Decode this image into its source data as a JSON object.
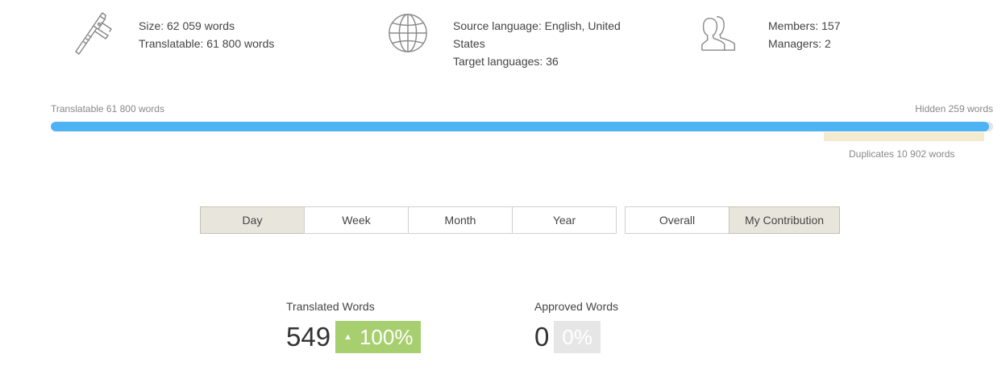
{
  "summary": {
    "size": {
      "icon": "caliper-icon",
      "size_line": "Size: 62 059 words",
      "translatable_line": "Translatable: 61 800 words"
    },
    "languages": {
      "icon": "globe-icon",
      "source_line": "Source language: English, United States",
      "target_line": "Target languages: 36"
    },
    "members": {
      "icon": "users-icon",
      "members_line": "Members: 157",
      "managers_line": "Managers: 2"
    }
  },
  "progress": {
    "translatable_label": "Translatable 61 800 words",
    "hidden_label": "Hidden 259 words",
    "duplicates_label": "Duplicates 10 902 words",
    "translatable_fraction": 0.9958,
    "colors": {
      "fill": "#4db3f3",
      "track": "#e4e4e4",
      "duplicates": "#f5ecd0"
    }
  },
  "period_tabs": [
    {
      "label": "Day",
      "active": true
    },
    {
      "label": "Week",
      "active": false
    },
    {
      "label": "Month",
      "active": false
    },
    {
      "label": "Year",
      "active": false
    }
  ],
  "scope_tabs": [
    {
      "label": "Overall",
      "active": false
    },
    {
      "label": "My Contribution",
      "active": true
    }
  ],
  "stats": {
    "translated": {
      "label": "Translated Words",
      "value": "549",
      "change": "100%",
      "change_icon": "arrow-up-icon",
      "badge_color": "#a7cf6f"
    },
    "approved": {
      "label": "Approved Words",
      "value": "0",
      "change": "0%",
      "badge_color": "#e6e6e6"
    }
  }
}
